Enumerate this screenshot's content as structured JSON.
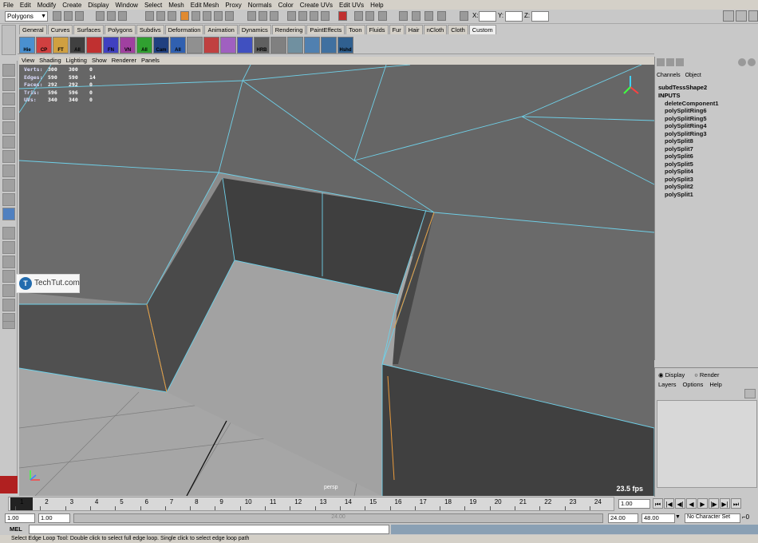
{
  "menu": [
    "File",
    "Edit",
    "Modify",
    "Create",
    "Display",
    "Window",
    "Select",
    "Mesh",
    "Edit Mesh",
    "Proxy",
    "Normals",
    "Color",
    "Create UVs",
    "Edit UVs",
    "Help"
  ],
  "status": {
    "mode": "Polygons",
    "x_label": "X:",
    "y_label": "Y:",
    "z_label": "Z:"
  },
  "shelf_tabs": [
    "General",
    "Curves",
    "Surfaces",
    "Polygons",
    "Subdivs",
    "Deformation",
    "Animation",
    "Dynamics",
    "Rendering",
    "PaintEffects",
    "Toon",
    "Fluids",
    "Fur",
    "Hair",
    "nCloth",
    "Cloth",
    "Custom"
  ],
  "shelf_active": "Custom",
  "shelf_buttons": [
    "Hie",
    "CP",
    "FT",
    "All",
    "",
    "FN",
    "VN",
    "All",
    "Cam",
    "All",
    "",
    "",
    "",
    "",
    "HRB",
    "",
    "",
    "",
    "",
    "Hshd"
  ],
  "panel_menu": [
    "View",
    "Shading",
    "Lighting",
    "Show",
    "Renderer",
    "Panels"
  ],
  "hud": [
    {
      "label": "Verts:",
      "a": "300",
      "b": "300",
      "c": "0"
    },
    {
      "label": "Edges:",
      "a": "590",
      "b": "590",
      "c": "14"
    },
    {
      "label": "Faces:",
      "a": "292",
      "b": "292",
      "c": "0"
    },
    {
      "label": "Tris:",
      "a": "596",
      "b": "596",
      "c": "0"
    },
    {
      "label": "UVs:",
      "a": "340",
      "b": "340",
      "c": "0"
    }
  ],
  "viewport": {
    "camera": "persp",
    "fps": "23.5 fps"
  },
  "watermark": "TechTut.com",
  "channel_box": {
    "menu": [
      "Channels",
      "Object"
    ],
    "node": "subdTessShape2",
    "inputs_label": "INPUTS",
    "inputs": [
      "deleteComponent1",
      "polySplitRing6",
      "polySplitRing5",
      "polySplitRing4",
      "polySplitRing3",
      "polySplit8",
      "polySplit7",
      "polySplit6",
      "polySplit5",
      "polySplit4",
      "polySplit3",
      "polySplit2",
      "polySplit1"
    ]
  },
  "layer_editor": {
    "display": "Display",
    "render": "Render",
    "menu": [
      "Layers",
      "Options",
      "Help"
    ]
  },
  "timeline": {
    "ticks": [
      "1",
      "2",
      "3",
      "4",
      "5",
      "6",
      "7",
      "8",
      "9",
      "10",
      "11",
      "12",
      "13",
      "14",
      "15",
      "16",
      "17",
      "18",
      "19",
      "20",
      "21",
      "22",
      "23",
      "24"
    ],
    "current": "1.00"
  },
  "range": {
    "start": "1.00",
    "start2": "1.00",
    "bar_label": "24.00",
    "end": "24.00",
    "end2": "48.00",
    "charset": "No Character Set"
  },
  "command": {
    "label": "MEL"
  },
  "help_line": "Select Edge Loop Tool: Double click to select full edge loop.  Single click to select edge loop path",
  "colors": {
    "viewport_bg": "#8b8b8b",
    "wire": "#6fd0e8",
    "selected_edge": "#e89a3c"
  }
}
